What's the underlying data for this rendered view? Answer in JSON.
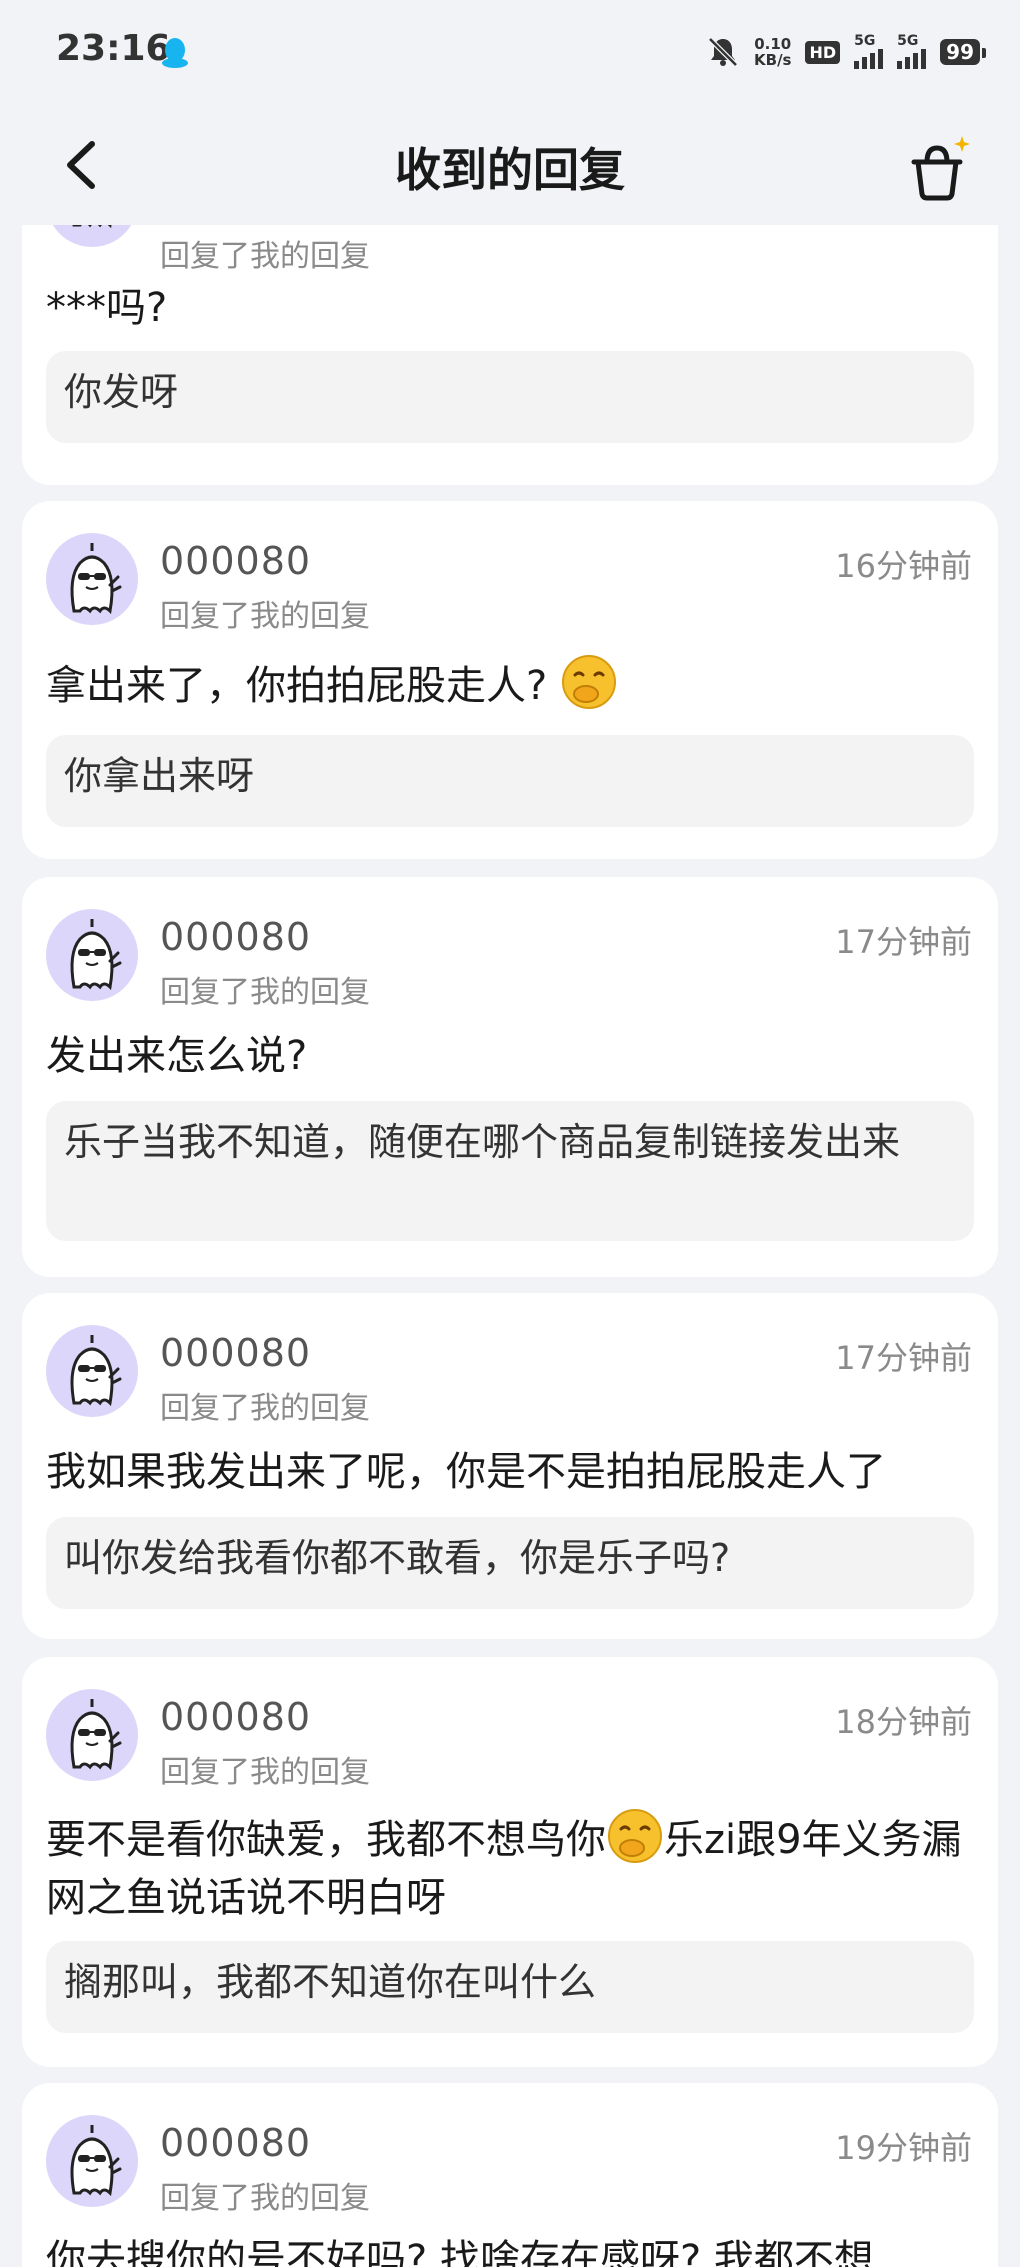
{
  "status_bar": {
    "time": "23:16",
    "net_speed_value": "0.10",
    "net_speed_unit": "KB/s",
    "hd_label": "HD",
    "sim1_label": "5G",
    "sim2_label": "5G",
    "battery": "99"
  },
  "nav": {
    "title": "收到的回复"
  },
  "replies": [
    {
      "username": "",
      "subline": "回复了我的回复",
      "time": "",
      "message": "***吗?",
      "quote": "你发呀"
    },
    {
      "username": "000080",
      "subline": "回复了我的回复",
      "time": "16分钟前",
      "message": "拿出来了，你拍拍屁股走人?",
      "quote": "你拿出来呀"
    },
    {
      "username": "000080",
      "subline": "回复了我的回复",
      "time": "17分钟前",
      "message": "发出来怎么说?",
      "quote": "乐子当我不知道，随便在哪个商品复制链接发出来"
    },
    {
      "username": "000080",
      "subline": "回复了我的回复",
      "time": "17分钟前",
      "message": "我如果我发出来了呢，你是不是拍拍屁股走人了",
      "quote": "叫你发给我看你都不敢看，你是乐子吗?"
    },
    {
      "username": "000080",
      "subline": "回复了我的回复",
      "time": "18分钟前",
      "message_part1": "要不是看你缺爱，我都不想鸟你",
      "message_part2": "乐zi跟9年义务漏网之鱼说话说不明白呀",
      "quote": "搁那叫，我都不知道你在叫什么"
    },
    {
      "username": "000080",
      "subline": "回复了我的回复",
      "time": "19分钟前",
      "message": "你去搜你的号不好吗? 找啥存在感呀? 我都不想"
    }
  ]
}
